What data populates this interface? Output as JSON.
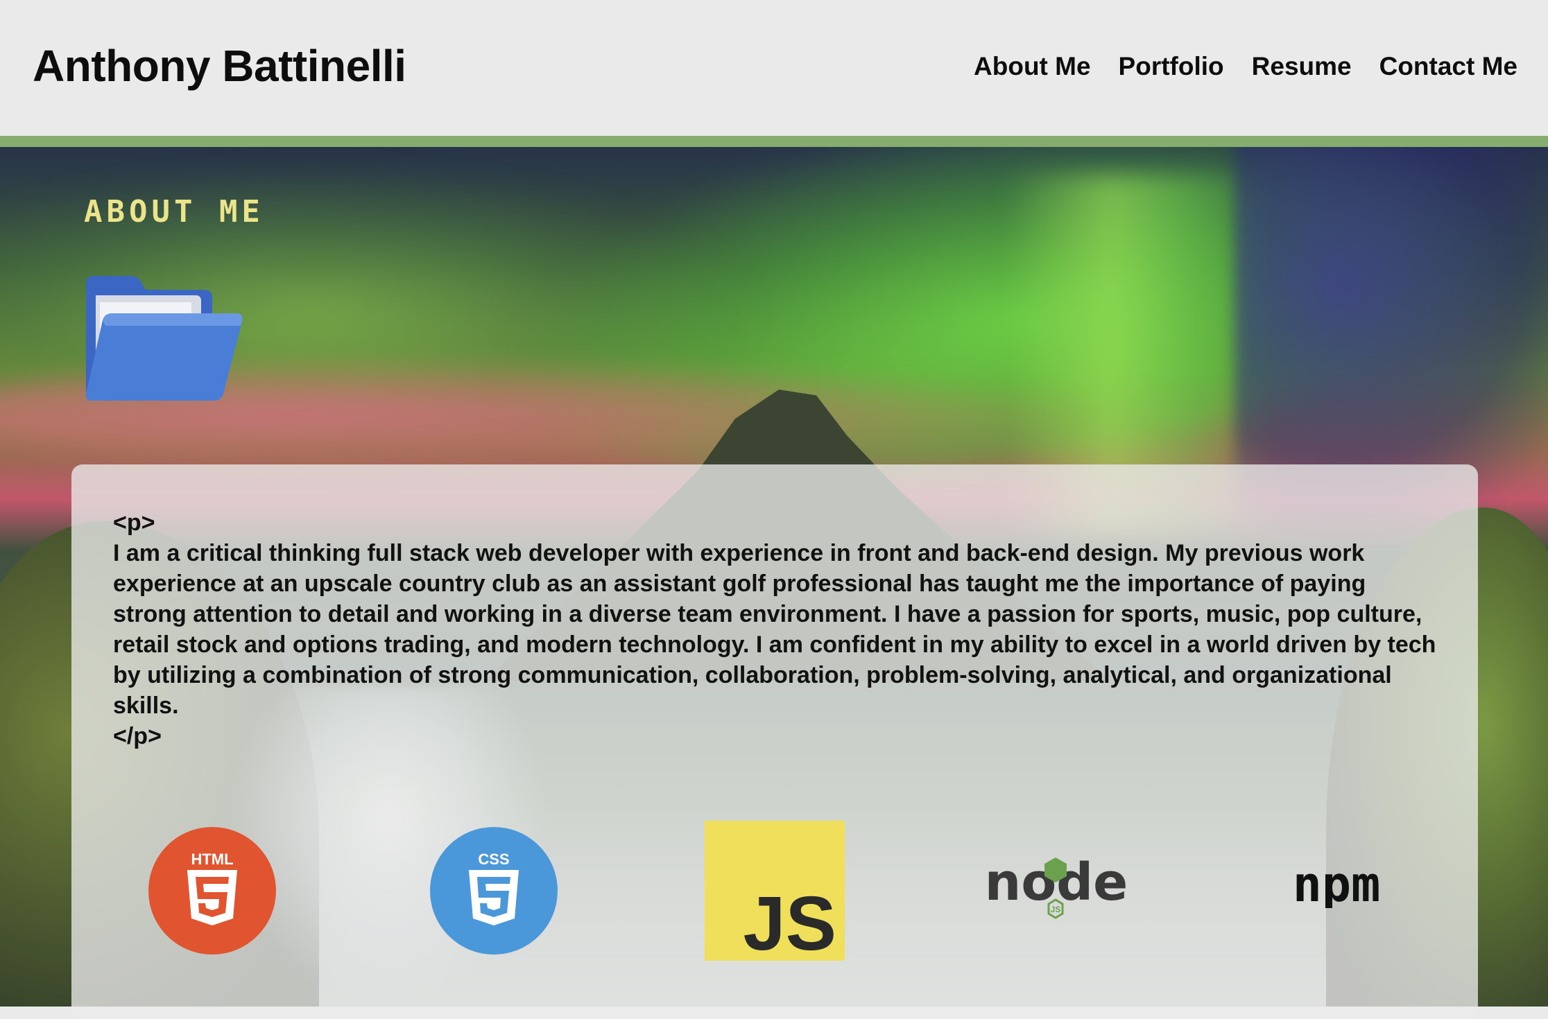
{
  "header": {
    "site_title": "Anthony Battinelli",
    "nav": [
      {
        "label": "About Me"
      },
      {
        "label": "Portfolio"
      },
      {
        "label": "Resume"
      },
      {
        "label": "Contact Me"
      }
    ],
    "stripe_color": "#86ac6e"
  },
  "about": {
    "heading": "ABOUT ME",
    "heading_color": "#ece48a",
    "folder_icon": "folder-open-icon",
    "open_tag": "<p>",
    "text": "I am a critical thinking full stack web developer with experience in front and back-end design. My previous work experience at an upscale country club as an assistant golf professional has taught me the importance of paying strong attention to detail and working in a diverse team environment. I have a passion for sports, music, pop culture, retail stock and options trading, and modern technology. I am confident in my ability to excel in a world driven by tech by utilizing a combination of strong communication, collaboration, problem-solving, analytical, and organizational skills.",
    "close_tag": "</p>"
  },
  "skills": [
    {
      "icon": "html5-icon",
      "label": "HTML",
      "color": "#e0552f"
    },
    {
      "icon": "css3-icon",
      "label": "CSS",
      "color": "#4a97d9"
    },
    {
      "icon": "javascript-icon",
      "label": "JS",
      "color": "#f0df5a"
    },
    {
      "icon": "nodejs-icon",
      "label": "node",
      "color": "#6ba14e"
    },
    {
      "icon": "npm-icon",
      "label": "npm",
      "color": "#111111"
    }
  ]
}
